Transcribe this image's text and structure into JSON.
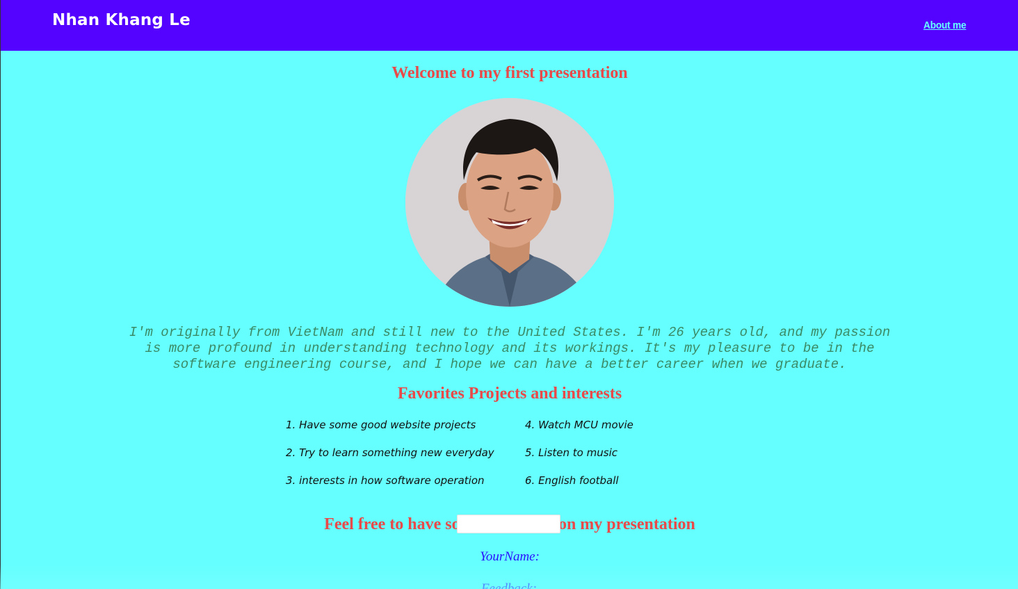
{
  "nav": {
    "brand": "Nhan Khang Le",
    "link_about": "About me",
    "background": "#5303ff"
  },
  "main": {
    "welcome_title": "Welcome to my first presentation",
    "intro_lines": [
      "I'm originally from VietNam and still new to the United States. I'm 26 years old, and my passion",
      "is more profound in understanding technology and its workings. It's my pleasure to be in the",
      "software engineering course, and I hope we can have a better career when we graduate."
    ],
    "projects_title": "Favorites Projects and interests",
    "projects_left": [
      "1. Have some good website projects",
      "2. Try to learn something new everyday",
      "3. interests in how software operation"
    ],
    "projects_right": [
      "4. Watch MCU movie",
      "5. Listen to music",
      "6. English football"
    ],
    "feedback_title": "Feel free to have some Feedback on my presentation",
    "form": {
      "name_label": "YourName:",
      "name_value": "",
      "feedback_label": "Feedback:"
    }
  },
  "colors": {
    "page_background": "#66ffff",
    "heading": "#e84a4a",
    "intro_text": "#3b8a66",
    "form_label": "#2a10ff",
    "nav_link": "#66ffff"
  },
  "icons": {
    "profile_photo": "profile-photo"
  }
}
